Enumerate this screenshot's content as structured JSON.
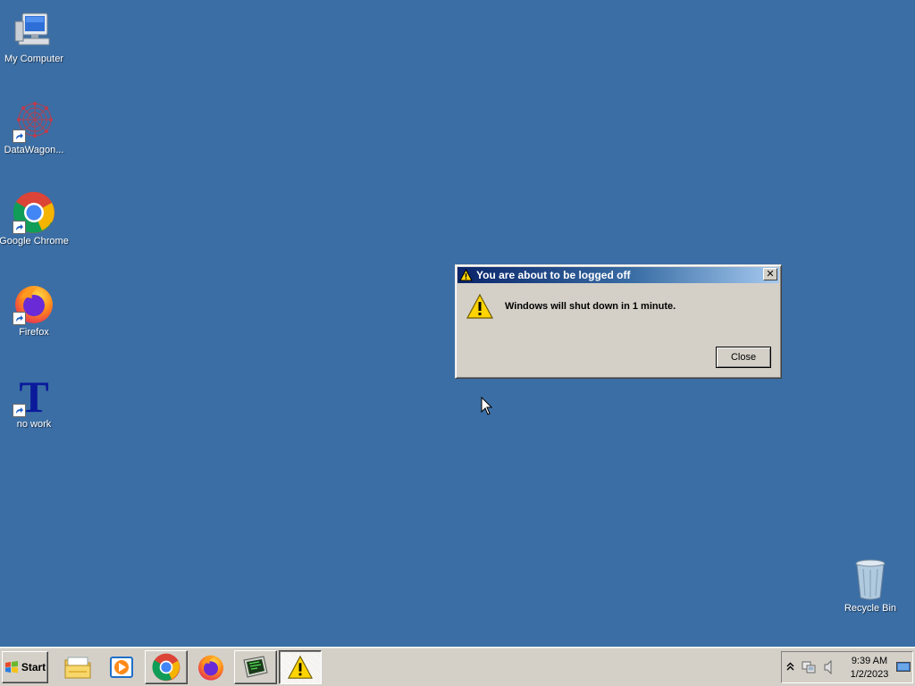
{
  "desktop": {
    "icons": [
      {
        "name": "my-computer",
        "label": "My Computer",
        "icon": "computer-icon"
      },
      {
        "name": "datawagon",
        "label": "DataWagon...",
        "icon": "datawagon-icon"
      },
      {
        "name": "google-chrome",
        "label": "Google Chrome",
        "icon": "chrome-icon"
      },
      {
        "name": "firefox",
        "label": "Firefox",
        "icon": "firefox-icon"
      },
      {
        "name": "no-work",
        "label": "no work",
        "icon": "text-t-icon"
      },
      {
        "name": "recycle-bin",
        "label": "Recycle Bin",
        "icon": "recycle-bin-icon"
      }
    ]
  },
  "dialog": {
    "title": "You are about to be logged off",
    "message": "Windows will shut down in 1 minute.",
    "close_button": "Close",
    "title_close_glyph": "✕",
    "icon": "warning-icon"
  },
  "taskbar": {
    "start_label": "Start",
    "apps": [
      {
        "name": "file-explorer",
        "icon": "folder-icon"
      },
      {
        "name": "media-player",
        "icon": "media-player-icon"
      },
      {
        "name": "chrome",
        "icon": "chrome-icon"
      },
      {
        "name": "firefox",
        "icon": "firefox-icon"
      },
      {
        "name": "terminal",
        "icon": "terminal-icon"
      },
      {
        "name": "warning-window",
        "icon": "warning-icon",
        "active": true
      }
    ],
    "tray": {
      "time": "9:39 AM",
      "date": "1/2/2023",
      "icons": [
        "chevron-up-icon",
        "network-icon",
        "volume-icon",
        "show-desktop-icon"
      ]
    }
  },
  "colors": {
    "desktop_bg": "#3b6ea5",
    "titlebar_start": "#0a246a",
    "titlebar_end": "#a6caf0",
    "face": "#d4d0c8"
  }
}
